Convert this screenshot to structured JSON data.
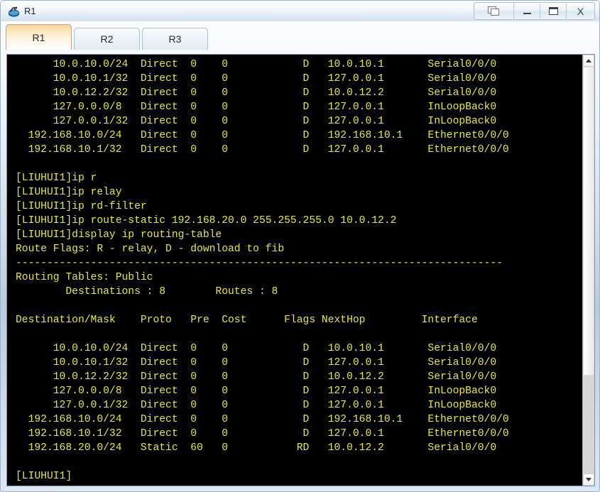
{
  "window": {
    "title": "R1",
    "app_icon": "router-icon",
    "controls": [
      {
        "name": "cascade-windows-button",
        "icon": "cascade-windows-icon",
        "label": ""
      },
      {
        "name": "minimize-button",
        "icon": "minimize-icon",
        "label": ""
      },
      {
        "name": "maximize-button",
        "icon": "maximize-icon",
        "label": ""
      },
      {
        "name": "close-button",
        "icon": "close-icon",
        "label": "X"
      }
    ]
  },
  "tabs": [
    {
      "label": "R1",
      "active": true
    },
    {
      "label": "R2",
      "active": false
    },
    {
      "label": "R3",
      "active": false
    }
  ],
  "terminal": {
    "background_color": "#000000",
    "text_color": "#e8e83c",
    "lines": [
      "      10.0.10.0/24  Direct  0    0            D   10.0.10.1       Serial0/0/0",
      "      10.0.10.1/32  Direct  0    0            D   127.0.0.1       Serial0/0/0",
      "      10.0.12.2/32  Direct  0    0            D   10.0.12.2       Serial0/0/0",
      "      127.0.0.0/8   Direct  0    0            D   127.0.0.1       InLoopBack0",
      "      127.0.0.1/32  Direct  0    0            D   127.0.0.1       InLoopBack0",
      "  192.168.10.0/24   Direct  0    0            D   192.168.10.1    Ethernet0/0/0",
      "  192.168.10.1/32   Direct  0    0            D   127.0.0.1       Ethernet0/0/0",
      "",
      "[LIUHUI1]ip r",
      "[LIUHUI1]ip relay",
      "[LIUHUI1]ip rd-filter",
      "[LIUHUI1]ip route-static 192.168.20.0 255.255.255.0 10.0.12.2",
      "[LIUHUI1]display ip routing-table",
      "Route Flags: R - relay, D - download to fib",
      "------------------------------------------------------------------------------",
      "Routing Tables: Public",
      "        Destinations : 8        Routes : 8",
      "",
      "Destination/Mask    Proto   Pre  Cost      Flags NextHop         Interface",
      "",
      "      10.0.10.0/24  Direct  0    0            D   10.0.10.1       Serial0/0/0",
      "      10.0.10.1/32  Direct  0    0            D   127.0.0.1       Serial0/0/0",
      "      10.0.12.2/32  Direct  0    0            D   10.0.12.2       Serial0/0/0",
      "      127.0.0.0/8   Direct  0    0            D   127.0.0.1       InLoopBack0",
      "      127.0.0.1/32  Direct  0    0            D   127.0.0.1       InLoopBack0",
      "  192.168.10.0/24   Direct  0    0            D   192.168.10.1    Ethernet0/0/0",
      "  192.168.10.1/32   Direct  0    0            D   127.0.0.1       Ethernet0/0/0",
      "  192.168.20.0/24   Static  60   0           RD   10.0.12.2       Serial0/0/0",
      "",
      "[LIUHUI1]"
    ]
  },
  "scrollbar": {
    "up_icon": "chevron-up-icon",
    "down_icon": "chevron-down-icon",
    "thumb_percent": 76
  }
}
